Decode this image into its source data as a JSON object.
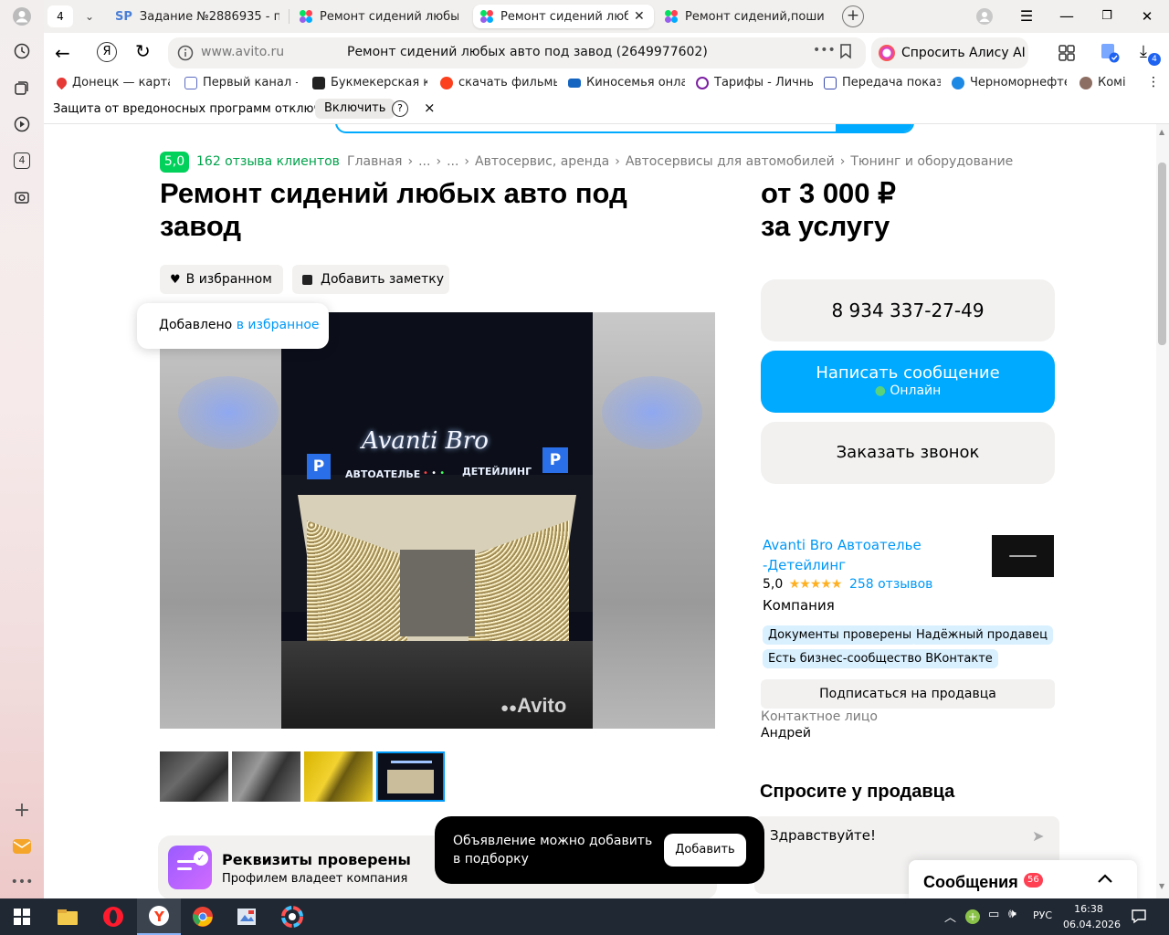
{
  "browser": {
    "tab_count": "4",
    "tabs": [
      {
        "title": "Задание №2886935 - про",
        "icon": "sp-icon"
      },
      {
        "title": "Ремонт сидений любых а",
        "icon": "avito-icon"
      },
      {
        "title": "Ремонт сидений любы",
        "icon": "avito-icon",
        "active": true
      },
      {
        "title": "Ремонт сидений,пошив ч",
        "icon": "avito-icon"
      }
    ],
    "address": {
      "domain": "www.avito.ru",
      "title": "Ремонт сидений любых авто под завод (2649977602)"
    },
    "alice_label": "Спросить Алису AI",
    "downloads_badge": "4",
    "bookmarks": [
      {
        "label": "Донецк — карта, г",
        "color": "#e53935"
      },
      {
        "label": "Первый канал — с",
        "color": "#5c6bc0"
      },
      {
        "label": "Букмекерская кон",
        "color": "#222222"
      },
      {
        "label": "скачать фильмы 2",
        "color": "#fc3f1d"
      },
      {
        "label": "Киносемья онлай",
        "color": "#1565c0"
      },
      {
        "label": "Тарифы - Личный",
        "color": "#7b1fa2"
      },
      {
        "label": "Передача показа",
        "color": "#3949ab"
      },
      {
        "label": "Черноморнефтег",
        "color": "#1e88e5"
      },
      {
        "label": "Комі",
        "color": "#8d6e63"
      }
    ],
    "protection": {
      "text": "Защита от вредоносных программ отключена",
      "enable_label": "Включить",
      "help": "?",
      "close": "×"
    }
  },
  "listing": {
    "rating": "5,0",
    "reviews_link": "162 отзыва клиентов",
    "breadcrumbs": [
      "Главная",
      "...",
      "...",
      "Автосервис, аренда",
      "Автосервисы для автомобилей",
      "Тюнинг и оборудование"
    ],
    "title": "Ремонт сидений любых авто под завод",
    "price_line1": "от 3 000 ₽",
    "price_line2": "за услугу",
    "fav_label": "В избранном",
    "note_label": "Добавить заметку",
    "tooltip_text": "Добавлено ",
    "tooltip_link": "в избранное",
    "photo_sign": "Avanti Bro",
    "photo_left_label": "АВТОАТЕЛЬЕ",
    "photo_right_label": "ДЕТЕЙЛИНГ",
    "photo_parking_left": "P",
    "photo_parking_right": "P",
    "photo_watermark": "Avito",
    "thumbs": [
      "thumb-1",
      "thumb-2",
      "thumb-3",
      "thumb-4"
    ],
    "verified_title": "Реквизиты проверены",
    "verified_sub": "Профилем владеет компания"
  },
  "seller_panel": {
    "phone": "8 934 337-27-49",
    "write_label": "Написать сообщение",
    "online_label": "Онлайн",
    "call_label": "Заказать звонок",
    "seller_name_1": "Avanti Bro Автоателье",
    "seller_name_2": "-Детейлинг",
    "seller_rating": "5,0",
    "stars": "★★★★★",
    "seller_reviews": "258 отзывов",
    "seller_type": "Компания",
    "tags": [
      "Документы проверены",
      "Надёжный продавец",
      "Есть бизнес-сообщество ВКонтакте"
    ],
    "subscribe_label": "Подписаться на продавца",
    "contact_label": "Контактное лицо",
    "contact_name": "Андрей",
    "ask_title": "Спросите у продавца",
    "ask_placeholder": "Здравствуйте!"
  },
  "toast": {
    "text_1": "Объявление можно добавить",
    "text_2": "в подборку",
    "button": "Добавить"
  },
  "messages": {
    "label": "Сообщения",
    "badge": "56"
  },
  "taskbar": {
    "lang": "РУС",
    "time": "16:38",
    "date": "06.04.2026"
  },
  "colors": {
    "avito_blue": "#00aaff",
    "rating_green": "#02d15c",
    "link_blue": "#0099f7"
  }
}
